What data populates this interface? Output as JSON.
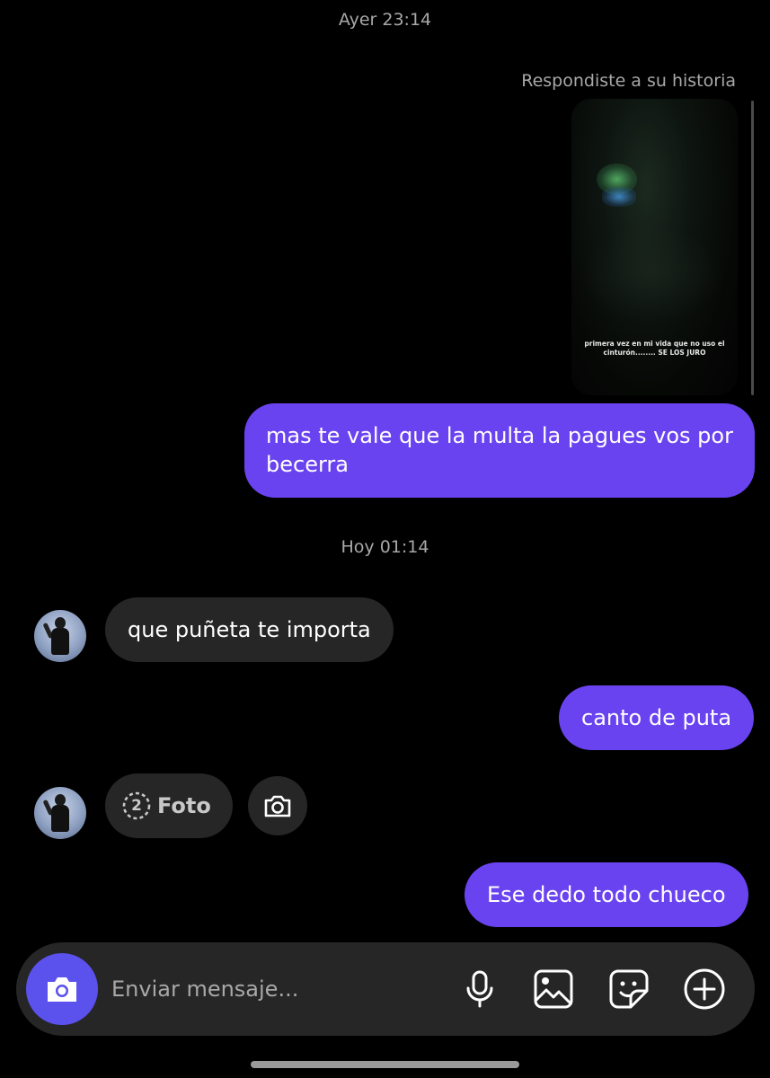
{
  "conversation": {
    "timestamp_1": "Ayer 23:14",
    "reply_context": "Respondiste a su historia",
    "story_caption": "primera vez en mi vida que no uso el cinturón........ SE LOS JURO",
    "timestamp_2": "Hoy 01:14"
  },
  "messages": [
    {
      "direction": "sent",
      "text": "mas te vale que la multa la pagues vos por becerra"
    },
    {
      "direction": "received",
      "text": "que puñeta te importa"
    },
    {
      "direction": "sent",
      "text": "canto de puta"
    },
    {
      "direction": "received",
      "type": "view-once-photo",
      "label": "Foto",
      "view_count": "2"
    },
    {
      "direction": "sent",
      "text": "Ese dedo todo chueco"
    }
  ],
  "composer": {
    "placeholder": "Enviar mensaje..."
  },
  "icons": {
    "composer_camera": "camera-icon",
    "mic": "microphone-icon",
    "gallery": "image-icon",
    "sticker": "sticker-icon",
    "more": "plus-circle-icon",
    "reply_camera": "camera-icon"
  },
  "colors": {
    "background": "#000000",
    "sent_bubble": "#6a43f0",
    "received_bubble": "#262626",
    "composer_camera": "#5b51ec",
    "secondary_text": "#a8a8a8"
  }
}
